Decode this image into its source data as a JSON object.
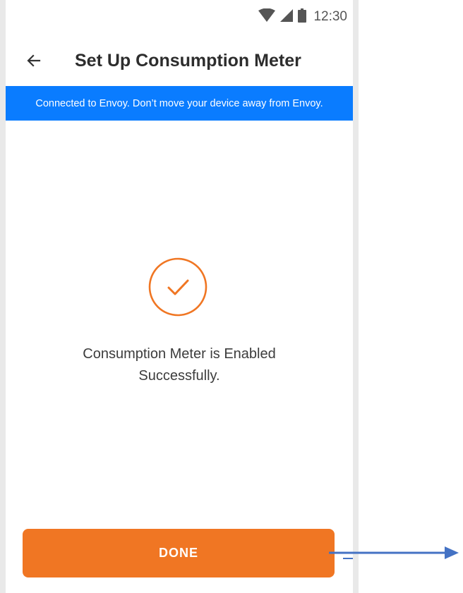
{
  "status_bar": {
    "time": "12:30",
    "icons": [
      "wifi-icon",
      "cell-signal-icon",
      "battery-icon"
    ]
  },
  "app_bar": {
    "back_icon": "arrow-left-icon",
    "title": "Set Up Consumption Meter"
  },
  "banner": {
    "text": "Connected to Envoy. Don’t move your device away from Envoy."
  },
  "main": {
    "success_icon": "check-circle-icon",
    "message_line1": "Consumption Meter is Enabled",
    "message_line2": "Successfully."
  },
  "footer": {
    "done_label": "DONE"
  },
  "annotation": {
    "icon": "arrow-right-icon"
  },
  "colors": {
    "accent_orange": "#f07623",
    "banner_blue": "#0a7cff",
    "annotation_blue": "#4472c4",
    "status_icon_gray": "#555555"
  }
}
